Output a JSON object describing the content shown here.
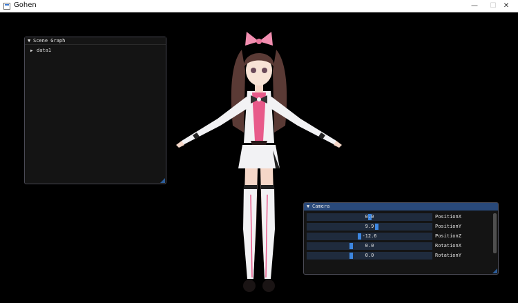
{
  "window": {
    "title": "Gohen",
    "minimize_glyph": "—",
    "maximize_glyph": "☐",
    "close_glyph": "✕"
  },
  "scene_graph": {
    "title": "Scene Graph",
    "collapse_glyph": "▼",
    "nodes": [
      {
        "label": "data1",
        "expand_glyph": "▶"
      }
    ]
  },
  "camera": {
    "title": "Camera",
    "collapse_glyph": "▼",
    "rows": [
      {
        "label": "PositionX",
        "value": "0.0",
        "fraction": 0.5
      },
      {
        "label": "PositionY",
        "value": "9.9",
        "fraction": 0.56
      },
      {
        "label": "PositionZ",
        "value": "-12.6",
        "fraction": 0.42
      },
      {
        "label": "RotationX",
        "value": "0.0",
        "fraction": 0.35
      },
      {
        "label": "RotationY",
        "value": "0.0",
        "fraction": 0.35
      }
    ]
  },
  "colors": {
    "panel_header_active": "#29497a",
    "slider_bg": "#1f2b3d",
    "slider_grab": "#3d86e0",
    "hair": "#5a3a35",
    "bow": "#f28eb0",
    "outfit": "#f2f2f4",
    "accent": "#e85a8a"
  }
}
